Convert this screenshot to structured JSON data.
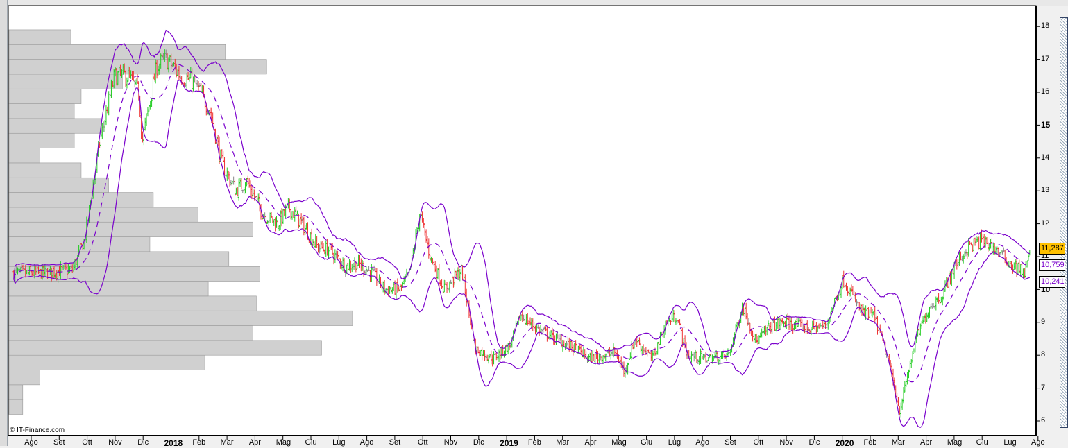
{
  "chart_data": {
    "type": "ohlc",
    "title": "",
    "credit": "© IT-Finance.com",
    "y_axis": {
      "range": [
        5.8,
        18.6
      ],
      "ticks": [
        "18",
        "17",
        "16",
        "15",
        "14",
        "13",
        "12",
        "11",
        "10",
        "9",
        "8",
        "7",
        "6"
      ],
      "bold_ticks": [
        "15",
        "10"
      ]
    },
    "x_axis": {
      "unit": "months since Aug 2017",
      "labels": [
        {
          "t": 0,
          "label": "Ago"
        },
        {
          "t": 1,
          "label": "Set"
        },
        {
          "t": 2,
          "label": "Ott"
        },
        {
          "t": 3,
          "label": "Nov"
        },
        {
          "t": 4,
          "label": "Dic"
        },
        {
          "t": 5,
          "label": "2018",
          "bold": true
        },
        {
          "t": 6,
          "label": "Feb"
        },
        {
          "t": 7,
          "label": "Mar"
        },
        {
          "t": 8,
          "label": "Apr"
        },
        {
          "t": 9,
          "label": "Mag"
        },
        {
          "t": 10,
          "label": "Giu"
        },
        {
          "t": 11,
          "label": "Lug"
        },
        {
          "t": 12,
          "label": "Ago"
        },
        {
          "t": 13,
          "label": "Set"
        },
        {
          "t": 14,
          "label": "Ott"
        },
        {
          "t": 15,
          "label": "Nov"
        },
        {
          "t": 16,
          "label": "Dic"
        },
        {
          "t": 17,
          "label": "2019",
          "bold": true
        },
        {
          "t": 18,
          "label": "Feb"
        },
        {
          "t": 19,
          "label": "Mar"
        },
        {
          "t": 20,
          "label": "Apr"
        },
        {
          "t": 21,
          "label": "Mag"
        },
        {
          "t": 22,
          "label": "Giu"
        },
        {
          "t": 23,
          "label": "Lug"
        },
        {
          "t": 24,
          "label": "Ago"
        },
        {
          "t": 25,
          "label": "Set"
        },
        {
          "t": 26,
          "label": "Ott"
        },
        {
          "t": 27,
          "label": "Nov"
        },
        {
          "t": 28,
          "label": "Dic"
        },
        {
          "t": 29,
          "label": "2020",
          "bold": true
        },
        {
          "t": 30,
          "label": "Feb"
        },
        {
          "t": 31,
          "label": "Mar"
        },
        {
          "t": 32,
          "label": "Apr"
        },
        {
          "t": 33,
          "label": "Mag"
        },
        {
          "t": 34,
          "label": "Giu"
        },
        {
          "t": 35,
          "label": "Lug"
        },
        {
          "t": 36,
          "label": "Ago"
        }
      ],
      "range": [
        -1.2,
        36.3
      ]
    },
    "price_path": [
      [
        -1.07,
        10.5
      ],
      [
        0,
        10.5
      ],
      [
        1.02,
        10.6
      ],
      [
        1.46,
        11.5
      ],
      [
        2.01,
        14.5
      ],
      [
        2.53,
        16.5
      ],
      [
        3.0,
        16.5
      ],
      [
        3.4,
        16.0
      ],
      [
        3.52,
        14.5
      ],
      [
        4.04,
        16.8
      ],
      [
        4.39,
        17.0
      ],
      [
        4.91,
        16.5
      ],
      [
        5.38,
        16.3
      ],
      [
        5.93,
        15.5
      ],
      [
        6.38,
        13.8
      ],
      [
        6.87,
        13.0
      ],
      [
        7.25,
        13.3
      ],
      [
        7.84,
        12.3
      ],
      [
        8.36,
        12.0
      ],
      [
        8.76,
        12.5
      ],
      [
        9.23,
        12.0
      ],
      [
        9.78,
        11.3
      ],
      [
        10.22,
        11.2
      ],
      [
        10.79,
        10.7
      ],
      [
        11.22,
        10.8
      ],
      [
        11.74,
        10.5
      ],
      [
        12.21,
        10.0
      ],
      [
        12.75,
        10.0
      ],
      [
        13.08,
        10.5
      ],
      [
        13.45,
        12.3
      ],
      [
        13.82,
        11.0
      ],
      [
        14.32,
        10.0
      ],
      [
        14.94,
        10.6
      ],
      [
        15.43,
        8.2
      ],
      [
        16.05,
        7.9
      ],
      [
        16.67,
        8.3
      ],
      [
        17.05,
        9.2
      ],
      [
        17.67,
        8.8
      ],
      [
        18.54,
        8.4
      ],
      [
        19.03,
        8.2
      ],
      [
        19.5,
        7.9
      ],
      [
        20.02,
        8.0
      ],
      [
        20.42,
        8.1
      ],
      [
        20.77,
        7.5
      ],
      [
        21.14,
        8.5
      ],
      [
        21.76,
        7.9
      ],
      [
        22.26,
        9.0
      ],
      [
        22.63,
        9.2
      ],
      [
        23.0,
        8.0
      ],
      [
        23.75,
        7.9
      ],
      [
        24.49,
        8.0
      ],
      [
        24.99,
        9.5
      ],
      [
        25.48,
        8.4
      ],
      [
        25.98,
        8.9
      ],
      [
        26.48,
        9.0
      ],
      [
        27.42,
        8.8
      ],
      [
        27.97,
        8.9
      ],
      [
        28.21,
        9.5
      ],
      [
        28.59,
        10.3
      ],
      [
        29.26,
        9.3
      ],
      [
        29.7,
        9.2
      ],
      [
        30.22,
        7.8
      ],
      [
        30.6,
        6.3
      ],
      [
        31.19,
        8.5
      ],
      [
        31.69,
        9.5
      ],
      [
        32.11,
        9.8
      ],
      [
        32.56,
        10.7
      ],
      [
        33.08,
        11.3
      ],
      [
        33.55,
        11.5
      ],
      [
        34.07,
        11.2
      ],
      [
        34.54,
        10.8
      ],
      [
        35.09,
        10.5
      ],
      [
        35.29,
        11.28
      ]
    ],
    "volume_profile": {
      "price_low": 6.2,
      "bin_size": 0.45,
      "relative_volumes": [
        0.04,
        0.04,
        0.09,
        0.57,
        0.91,
        0.71,
        1.0,
        0.72,
        0.58,
        0.73,
        0.64,
        0.41,
        0.71,
        0.55,
        0.42,
        0.29,
        0.21,
        0.09,
        0.19,
        0.27,
        0.19,
        0.21,
        0.33,
        0.75,
        0.63,
        0.18
      ]
    },
    "bollinger": {
      "period": 20,
      "stddev": 2
    },
    "last_values": {
      "close": "11,287",
      "upper": "10,759",
      "lower": "10,241"
    }
  },
  "colors": {
    "up": "#22cc22",
    "down": "#ee3333",
    "flat": "#888888",
    "band": "#7a00cc",
    "profile": "#d0d0d0",
    "highlight": "#ffc000"
  }
}
